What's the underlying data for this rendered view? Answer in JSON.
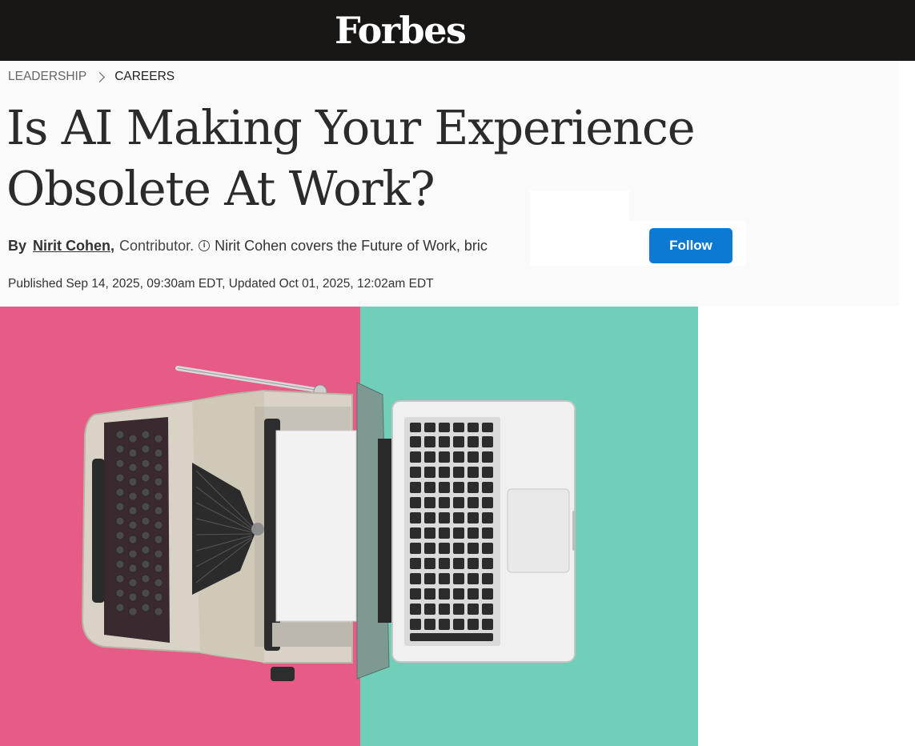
{
  "site": {
    "logo_text": "Forbes"
  },
  "breadcrumb": {
    "items": [
      "LEADERSHIP",
      "CAREERS"
    ]
  },
  "article": {
    "headline": "Is AI Making Your Experience Obsolete At Work?",
    "byline": {
      "by_label": "By",
      "author": "Nirit Cohen",
      "comma": ",",
      "role": "Contributor.",
      "bio": "Nirit Cohen covers the Future of Work, bric"
    },
    "follow_label": "Follow",
    "dates": "Published Sep 14, 2025, 09:30am EDT, Updated Oct 01, 2025, 12:02am EDT"
  },
  "colors": {
    "topbar": "#181716",
    "follow_button": "#0c79d3",
    "hero_left": "#e65c87",
    "hero_right": "#6fcfb9"
  },
  "icons": [
    "info-icon",
    "chevron-right-icon"
  ]
}
